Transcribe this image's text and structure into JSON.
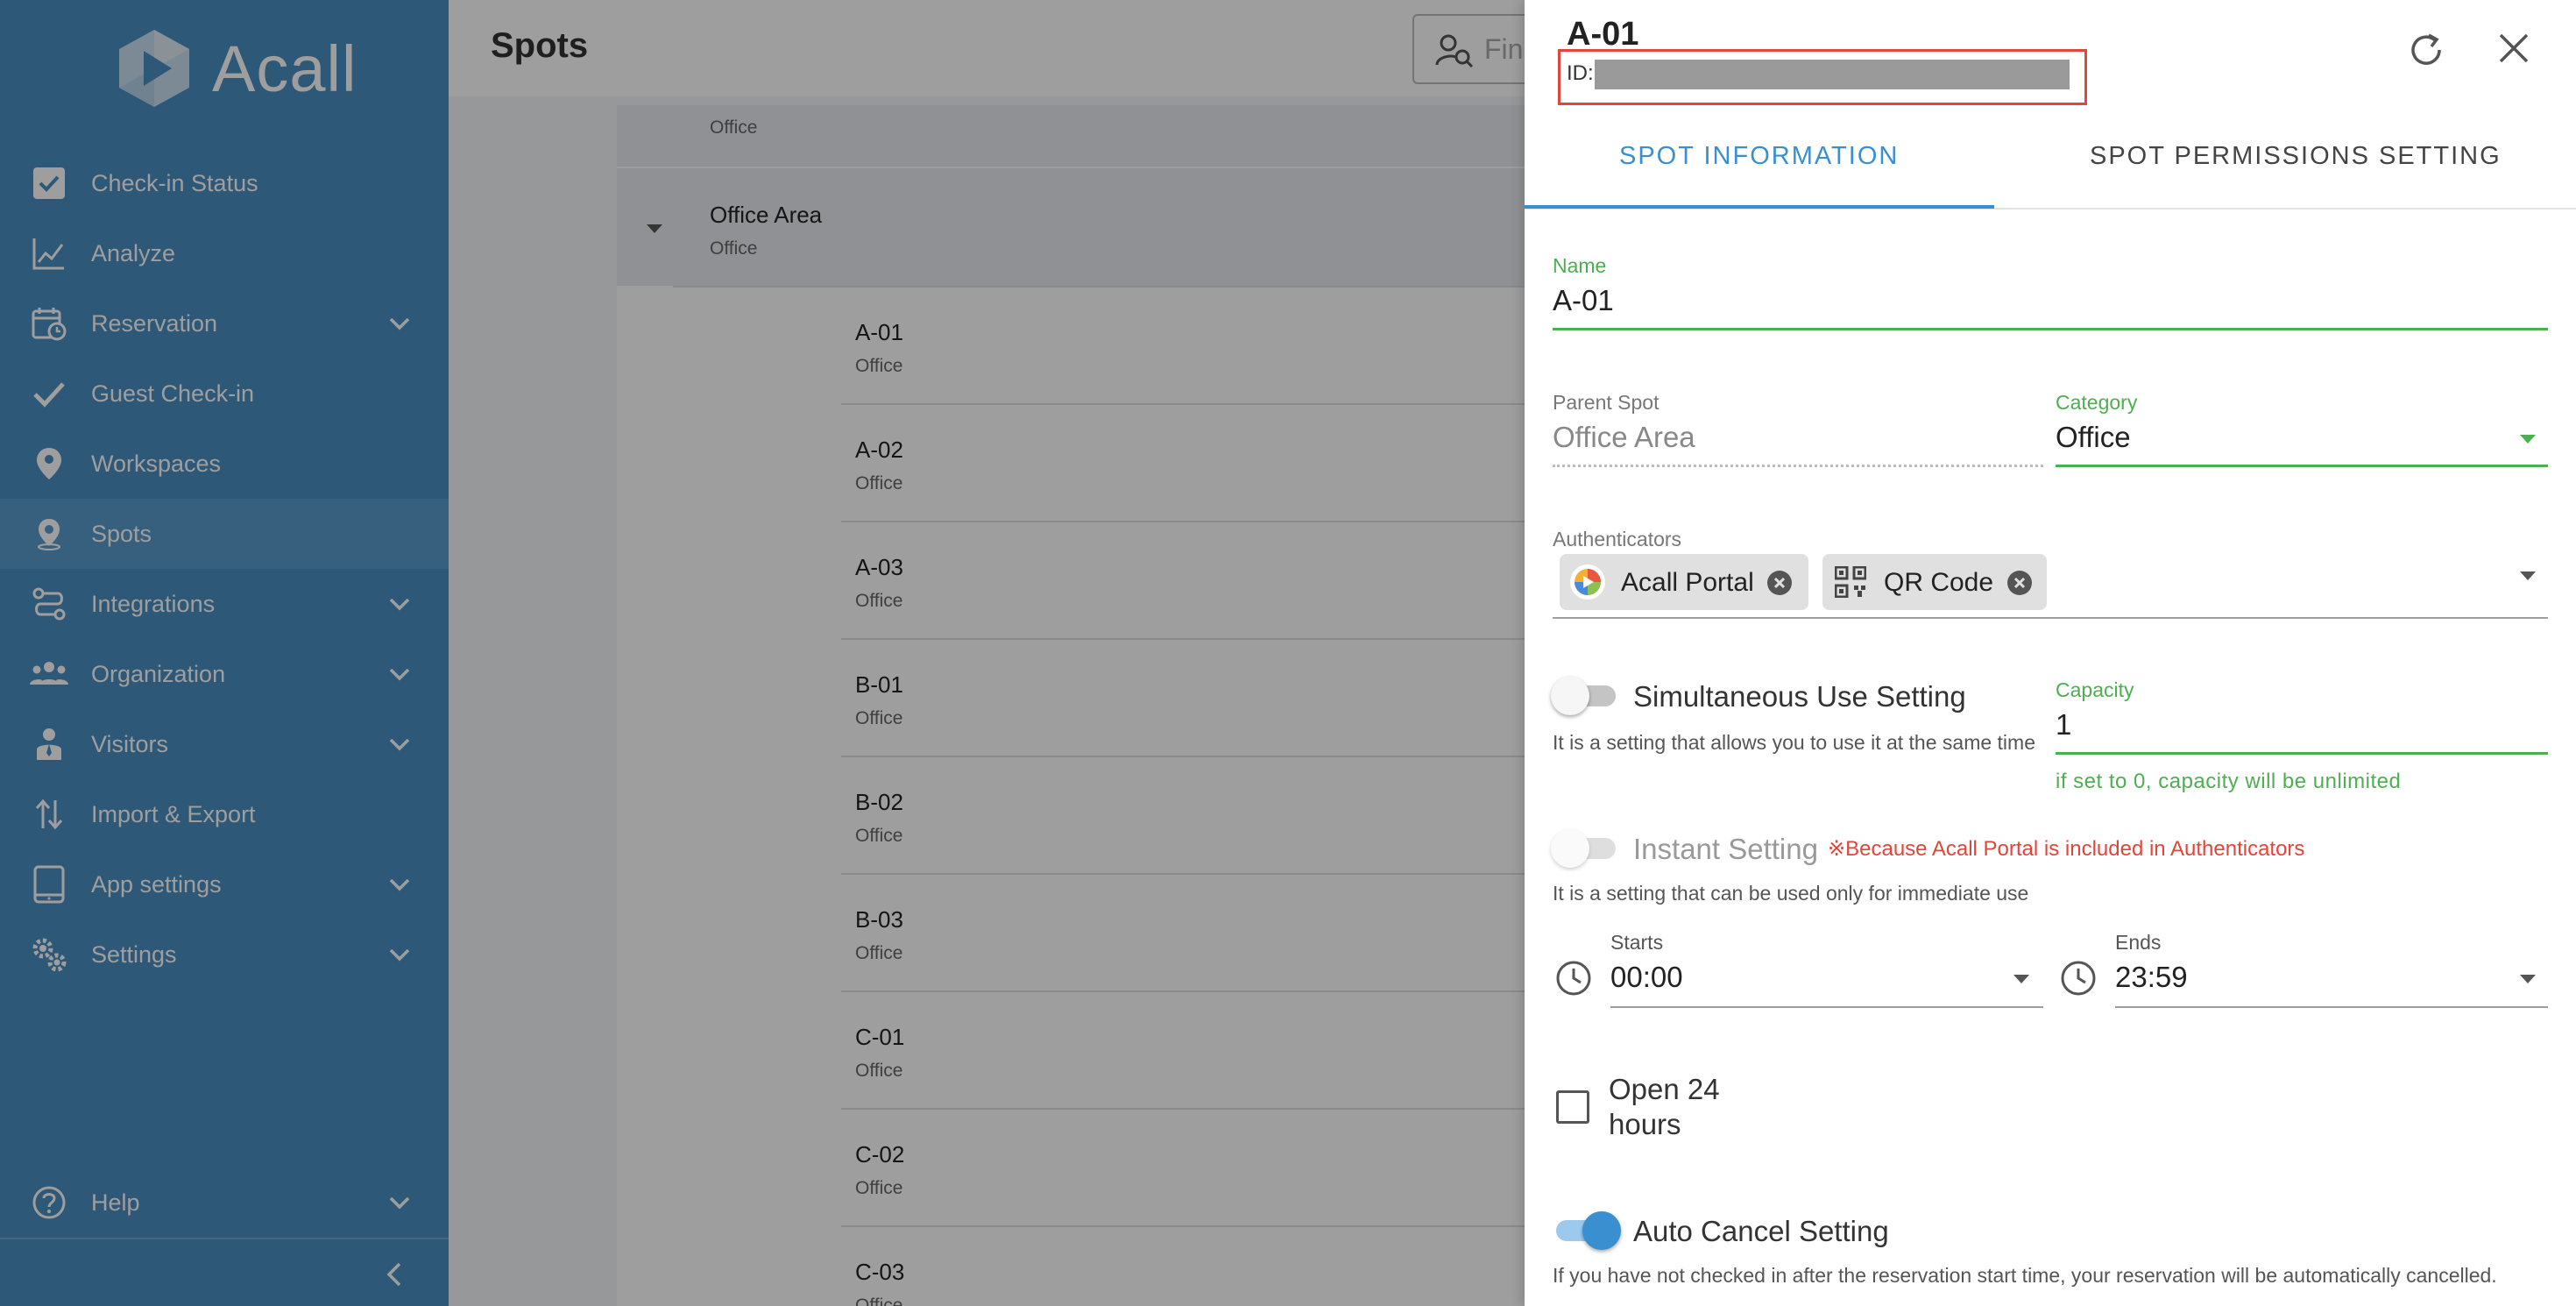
{
  "app": {
    "logo_text": "Acall"
  },
  "sidebar": {
    "items": [
      {
        "label": "Check-in Status",
        "icon": "check-square-icon"
      },
      {
        "label": "Analyze",
        "icon": "chart-line-icon"
      },
      {
        "label": "Reservation",
        "icon": "calendar-clock-icon",
        "expandable": true
      },
      {
        "label": "Guest Check-in",
        "icon": "checkmark-icon"
      },
      {
        "label": "Workspaces",
        "icon": "map-pin-icon"
      },
      {
        "label": "Spots",
        "icon": "map-pin-outline-icon",
        "active": true
      },
      {
        "label": "Integrations",
        "icon": "integrations-icon",
        "expandable": true
      },
      {
        "label": "Organization",
        "icon": "people-icon",
        "expandable": true
      },
      {
        "label": "Visitors",
        "icon": "visitor-icon",
        "expandable": true
      },
      {
        "label": "Import & Export",
        "icon": "import-export-icon"
      },
      {
        "label": "App settings",
        "icon": "tablet-icon",
        "expandable": true
      },
      {
        "label": "Settings",
        "icon": "gears-icon",
        "expandable": true
      }
    ],
    "help": {
      "label": "Help",
      "icon": "help-circle-icon"
    }
  },
  "main": {
    "title": "Spots",
    "search_placeholder": "Fin",
    "tree": {
      "top_cat": "Office",
      "group": {
        "name": "Office Area",
        "category": "Office"
      },
      "rows": [
        {
          "name": "A-01",
          "category": "Office"
        },
        {
          "name": "A-02",
          "category": "Office"
        },
        {
          "name": "A-03",
          "category": "Office"
        },
        {
          "name": "B-01",
          "category": "Office"
        },
        {
          "name": "B-02",
          "category": "Office"
        },
        {
          "name": "B-03",
          "category": "Office"
        },
        {
          "name": "C-01",
          "category": "Office"
        },
        {
          "name": "C-02",
          "category": "Office"
        },
        {
          "name": "C-03",
          "category": "Office"
        }
      ]
    }
  },
  "drawer": {
    "title": "A-01",
    "id_label": "ID:",
    "tabs": [
      "SPOT INFORMATION",
      "SPOT PERMISSIONS SETTING"
    ],
    "name": {
      "label": "Name",
      "value": "A-01"
    },
    "parent_spot": {
      "label": "Parent Spot",
      "value": "Office Area"
    },
    "category": {
      "label": "Category",
      "value": "Office"
    },
    "authenticators": {
      "label": "Authenticators",
      "chips": [
        "Acall Portal",
        "QR Code"
      ]
    },
    "simultaneous": {
      "title": "Simultaneous Use Setting",
      "desc": "It is a setting that allows you to use it at the same time",
      "on": false
    },
    "capacity": {
      "label": "Capacity",
      "value": "1",
      "hint": "if set to 0, capacity will be unlimited"
    },
    "instant": {
      "title": "Instant Setting",
      "warning": "※Because Acall Portal is included in Authenticators",
      "desc": "It is a setting that can be used only for immediate use",
      "on": false
    },
    "starts": {
      "label": "Starts",
      "value": "00:00"
    },
    "ends": {
      "label": "Ends",
      "value": "23:59"
    },
    "open24": {
      "label_line1": "Open 24",
      "label_line2": "hours",
      "checked": false
    },
    "auto_cancel": {
      "title": "Auto Cancel Setting",
      "desc": "If you have not checked in after the reservation start time, your reservation will be automatically cancelled.",
      "on": true
    }
  },
  "colors": {
    "sidebar_bg": "#4a8ec2",
    "accent_blue": "#3a8fd1",
    "valid_green": "#4caf50",
    "warning_red": "#e0463a"
  }
}
